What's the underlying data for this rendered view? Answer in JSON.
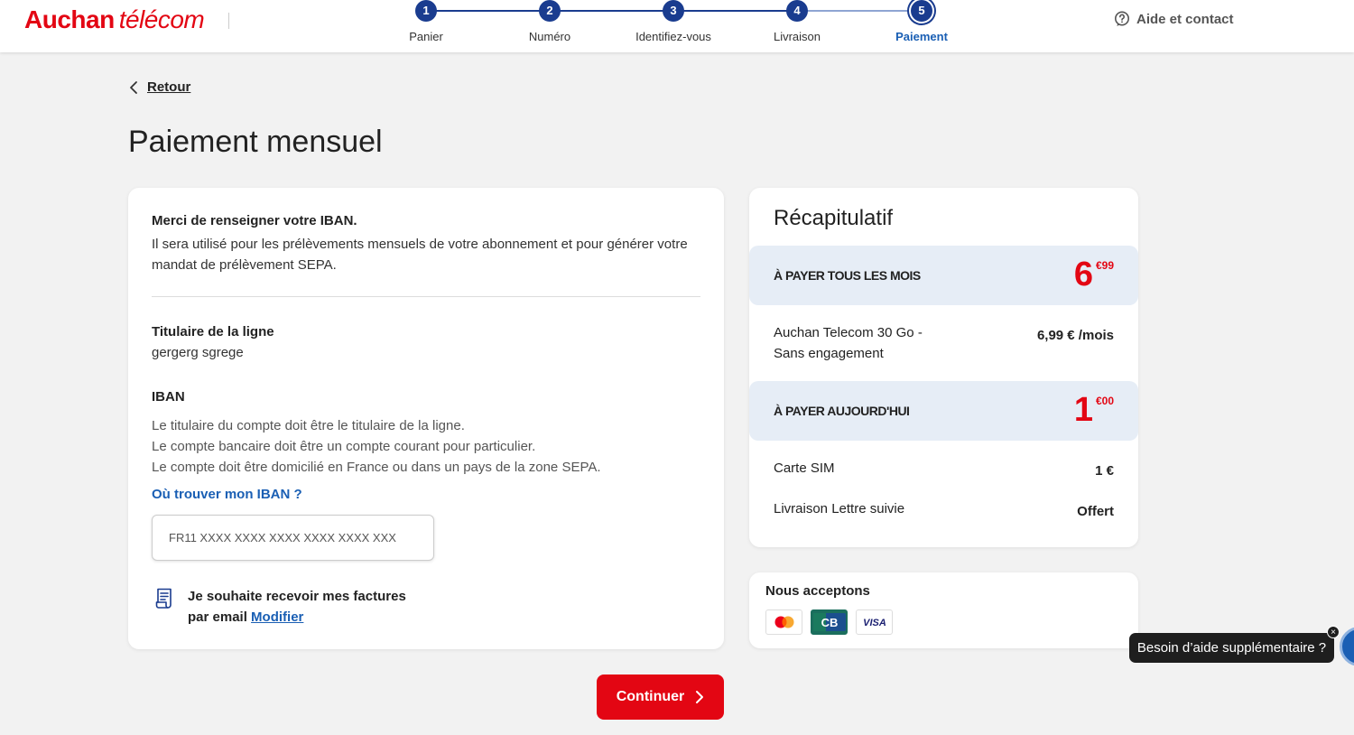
{
  "header": {
    "logo_brand": "Auchan",
    "logo_sub": "télécom",
    "steps": [
      {
        "num": "1",
        "label": "Panier"
      },
      {
        "num": "2",
        "label": "Numéro"
      },
      {
        "num": "3",
        "label": "Identifiez-vous"
      },
      {
        "num": "4",
        "label": "Livraison"
      },
      {
        "num": "5",
        "label": "Paiement"
      }
    ],
    "help_label": "Aide et contact"
  },
  "back_label": "Retour",
  "page_title": "Paiement mensuel",
  "iban_form": {
    "intro_bold": "Merci de renseigner votre IBAN.",
    "intro_text": "Il sera utilisé pour les prélèvements mensuels de votre abonnement et pour générer votre mandat de prélèvement SEPA.",
    "holder_label": "Titulaire de la ligne",
    "holder_value": "gergerg sgrege",
    "iban_label": "IBAN",
    "rules": [
      "Le titulaire du compte doit être le titulaire de la ligne.",
      "Le compte bancaire doit être un compte courant pour particulier.",
      "Le compte doit être domicilié en France ou dans un pays de la zone SEPA."
    ],
    "find_iban_link": "Où trouver mon IBAN ?",
    "iban_placeholder": "FR11 XXXX XXXX XXXX XXXX XXXX XXX",
    "invoice_line1": "Je souhaite recevoir mes factures",
    "invoice_line2": "par email",
    "invoice_modify": "Modifier"
  },
  "recap": {
    "title": "Récapitulatif",
    "monthly_label": "À PAYER TOUS LES MOIS",
    "monthly_int": "6",
    "monthly_cents": "€99",
    "offer_line1": "Auchan Telecom 30 Go -",
    "offer_line2": "Sans engagement",
    "offer_price": "6,99 € /mois",
    "today_label": "À PAYER AUJOURD'HUI",
    "today_int": "1",
    "today_cents": "€00",
    "sim_label": "Carte SIM",
    "sim_price": "1 €",
    "delivery_label": "Livraison Lettre suivie",
    "delivery_price": "Offert"
  },
  "accept": {
    "label": "Nous acceptons",
    "cards": [
      "mastercard-icon",
      "cb-icon",
      "visa-icon"
    ],
    "visa_text": "VISA",
    "cb_text": "CB"
  },
  "continue_label": "Continuer",
  "help_bubble": "Besoin d’aide supplémentaire ?",
  "colors": {
    "brand_red": "#e30613",
    "stepper_blue": "#1a3c8f",
    "link_blue": "#1a5fb4",
    "band_bg": "#e6edf6"
  }
}
